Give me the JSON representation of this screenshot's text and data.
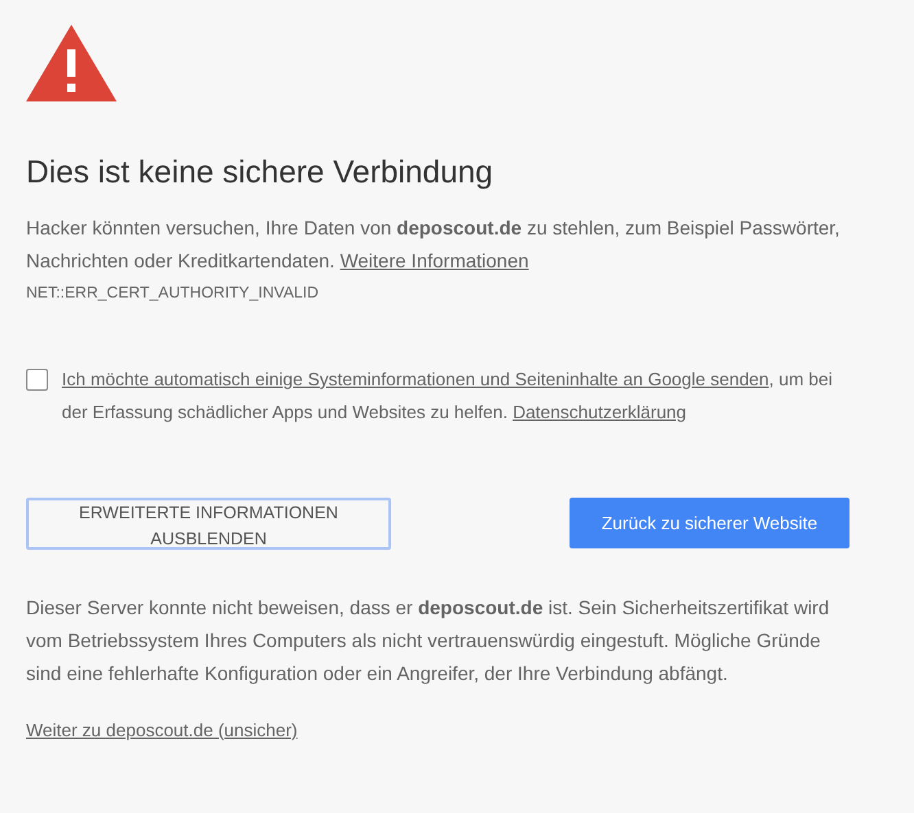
{
  "title": "Dies ist keine sichere Verbindung",
  "intro": {
    "text": "Hacker könnten versuchen, Ihre Daten von **deposcout.de** zu stehlen, zum Beispiel Passwörter, Nachrichten oder Kreditkartendaten.",
    "link": "Weitere Informationen"
  },
  "error_code": "NET::ERR_CERT_AUTHORITY_INVALID",
  "report": {
    "checked": false,
    "link": "Ich möchte automatisch einige Systeminformationen und Seiteninhalte an Google senden",
    "text": ", um bei der Erfassung schädlicher Apps und Websites zu helfen.",
    "privacy_link": "Datenschutzerklärung"
  },
  "buttons": [
    {
      "label": "ERWEITERTE INFORMATIONEN AUSBLENDEN",
      "kind": "details"
    },
    {
      "label": "Zurück zu sicherer Website",
      "kind": "primary"
    }
  ],
  "details": "Dieser Server konnte nicht beweisen, dass er **deposcout.de** ist. Sein Sicherheitszertifikat wird vom Betriebssystem Ihres Computers als nicht vertrauenswürdig eingestuft. Mögliche Gründe sind eine fehlerhafte Konfiguration oder ein Angreifer, der Ihre Verbindung abfängt.",
  "proceed_link": "Weiter zu deposcout.de (unsicher)"
}
